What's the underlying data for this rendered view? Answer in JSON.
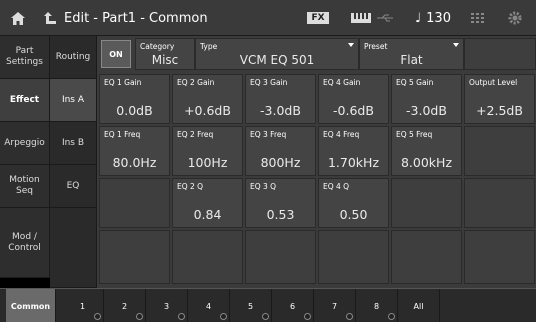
{
  "header": {
    "title": "Edit - Part1 - Common",
    "fx_label": "FX",
    "tempo": "130"
  },
  "nav_primary": [
    {
      "label": "Part\nSettings",
      "active": false
    },
    {
      "label": "Effect",
      "active": true
    },
    {
      "label": "Arpeggio",
      "active": false
    },
    {
      "label": "Motion\nSeq",
      "active": false
    },
    {
      "label": "Mod /\nControl",
      "active": false
    }
  ],
  "nav_secondary": [
    {
      "label": "Routing",
      "active": false
    },
    {
      "label": "Ins A",
      "active": true
    },
    {
      "label": "Ins B",
      "active": false
    },
    {
      "label": "EQ",
      "active": false
    }
  ],
  "top_row": {
    "on_label": "ON",
    "category_label": "Category",
    "category_value": "Misc",
    "type_label": "Type",
    "type_value": "VCM EQ 501",
    "preset_label": "Preset",
    "preset_value": "Flat"
  },
  "gain_row": [
    {
      "label": "EQ 1 Gain",
      "value": "0.0dB"
    },
    {
      "label": "EQ 2 Gain",
      "value": "+0.6dB"
    },
    {
      "label": "EQ 3 Gain",
      "value": "-3.0dB"
    },
    {
      "label": "EQ 4 Gain",
      "value": "-0.6dB"
    },
    {
      "label": "EQ 5 Gain",
      "value": "-3.0dB"
    },
    {
      "label": "Output Level",
      "value": "+2.5dB"
    }
  ],
  "freq_row": [
    {
      "label": "EQ 1 Freq",
      "value": "80.0Hz"
    },
    {
      "label": "EQ 2 Freq",
      "value": "100Hz"
    },
    {
      "label": "EQ 3 Freq",
      "value": "800Hz"
    },
    {
      "label": "EQ 4 Freq",
      "value": "1.70kHz"
    },
    {
      "label": "EQ 5 Freq",
      "value": "8.00kHz"
    }
  ],
  "q_row": [
    {
      "label": "EQ 2 Q",
      "value": "0.84"
    },
    {
      "label": "EQ 3 Q",
      "value": "0.53"
    },
    {
      "label": "EQ 4 Q",
      "value": "0.50"
    }
  ],
  "footer": {
    "common_label": "Common",
    "parts": [
      "1",
      "2",
      "3",
      "4",
      "5",
      "6",
      "7",
      "8"
    ],
    "all_label": "All"
  }
}
